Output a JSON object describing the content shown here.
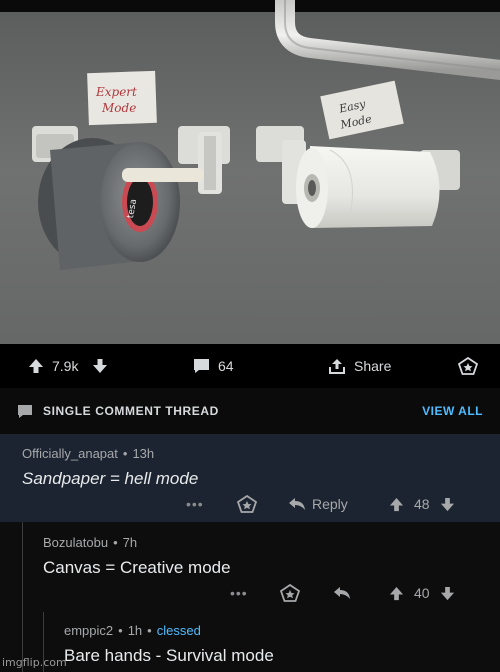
{
  "post": {
    "image": {
      "sign_left": [
        "Expert",
        "Mode"
      ],
      "sign_right": [
        "Easy",
        "Mode"
      ],
      "tape_brand": "tesa"
    },
    "action_bar": {
      "upvotes": "7.9k",
      "comments": "64",
      "share_label": "Share"
    }
  },
  "thread": {
    "header_title": "SINGLE COMMENT THREAD",
    "view_all_label": "VIEW ALL"
  },
  "comments": [
    {
      "author": "Officially_anapat",
      "age": "13h",
      "body": "Sandpaper = hell mode",
      "reply_label": "Reply",
      "score": "48"
    },
    {
      "author": "Bozulatobu",
      "age": "7h",
      "body": "Canvas = Creative mode",
      "score": "40"
    },
    {
      "author": "emppic2",
      "age": "1h",
      "flair": "clessed",
      "body": "Bare hands - Survival mode"
    }
  ],
  "watermark": "imgflip.com",
  "colors": {
    "background": "#000000",
    "highlighted_comment_bg": "#1b2430",
    "link_blue": "#4fbcff",
    "text": "#d7dadc"
  }
}
